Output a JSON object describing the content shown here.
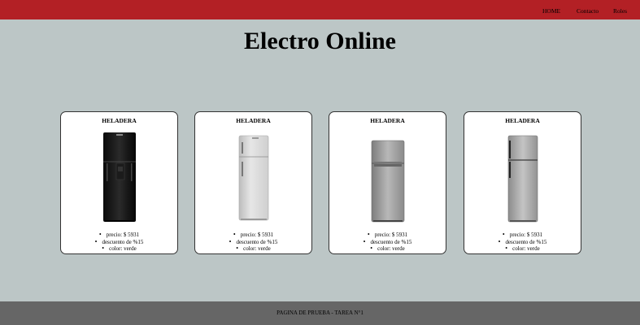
{
  "nav": {
    "items": [
      "HOME",
      "Contacto",
      "Roles"
    ]
  },
  "page": {
    "title": "Electro Online"
  },
  "products": [
    {
      "title": "HELADERA",
      "details": [
        "precio: $ 5931",
        "descuento de %15",
        "color: verde"
      ],
      "image": "black-fridge"
    },
    {
      "title": "HELADERA",
      "details": [
        "precio: $ 5931",
        "descuento de %15",
        "color: verde"
      ],
      "image": "white-fridge"
    },
    {
      "title": "HELADERA",
      "details": [
        "precio: $ 5931",
        "descuento de %15",
        "color: verde"
      ],
      "image": "steel-fridge"
    },
    {
      "title": "HELADERA",
      "details": [
        "precio: $ 5931",
        "descuento de %15",
        "color: verde"
      ],
      "image": "silver-fridge"
    }
  ],
  "footer": {
    "text": "PAGINA DE PRUEBA - TAREA N°1"
  },
  "colors": {
    "topbar": "#b32025",
    "background": "#bcc6c6",
    "footer": "#666666"
  }
}
